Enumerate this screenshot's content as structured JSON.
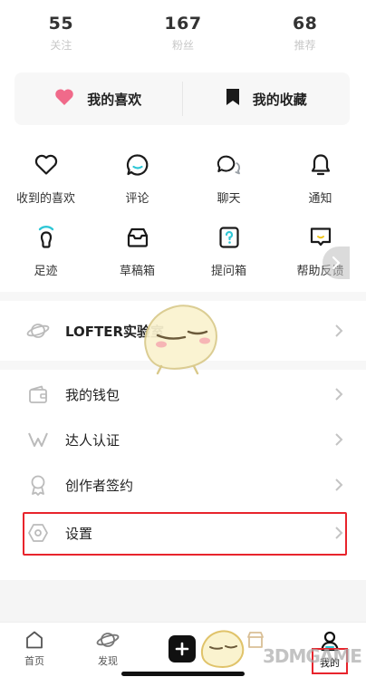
{
  "stats": [
    {
      "value": "55",
      "label": "关注"
    },
    {
      "value": "167",
      "label": "粉丝"
    },
    {
      "value": "68",
      "label": "推荐"
    }
  ],
  "favorites": {
    "likes_label": "我的喜欢",
    "collections_label": "我的收藏"
  },
  "grid": {
    "row1": [
      {
        "label": "收到的喜欢",
        "icon": "heart-outline-icon"
      },
      {
        "label": "评论",
        "icon": "comment-icon"
      },
      {
        "label": "聊天",
        "icon": "chat-icon"
      },
      {
        "label": "通知",
        "icon": "bell-icon"
      }
    ],
    "row2": [
      {
        "label": "足迹",
        "icon": "footprint-icon"
      },
      {
        "label": "草稿箱",
        "icon": "draft-box-icon"
      },
      {
        "label": "提问箱",
        "icon": "question-box-icon"
      },
      {
        "label": "帮助反馈",
        "icon": "feedback-icon"
      }
    ]
  },
  "list": [
    {
      "label": "LOFTER实验室",
      "icon": "planet-icon"
    },
    {
      "label": "我的钱包",
      "icon": "wallet-icon"
    },
    {
      "label": "达人认证",
      "icon": "verified-v-icon"
    },
    {
      "label": "创作者签约",
      "icon": "badge-icon"
    },
    {
      "label": "设置",
      "icon": "settings-hexagon-icon"
    }
  ],
  "tabbar": {
    "home": "首页",
    "discover": "发现",
    "me": "我的"
  },
  "watermark": "3DMGAME",
  "colors": {
    "heart": "#f06a8a",
    "highlight": "#e8242c",
    "accent_cyan": "#2ec7d6",
    "grey_text": "#c8c8c8"
  }
}
